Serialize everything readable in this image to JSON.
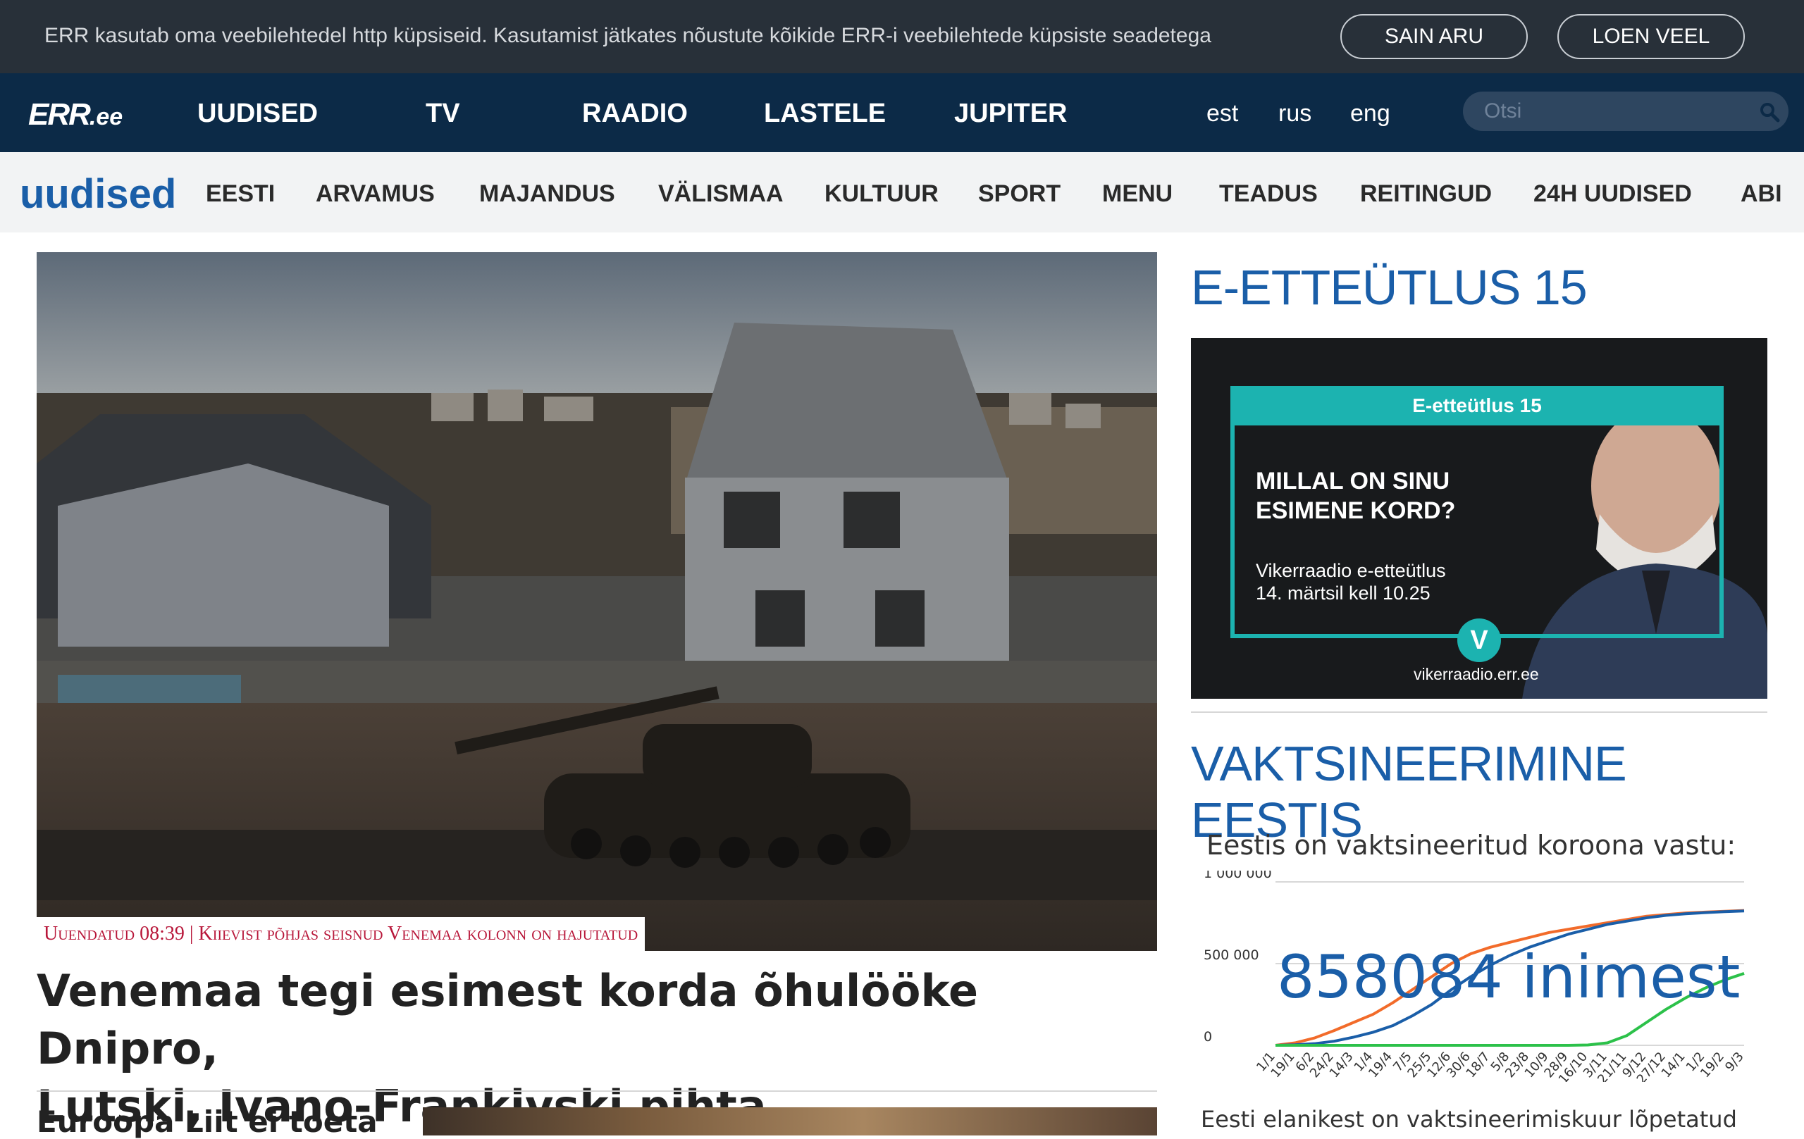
{
  "cookie": {
    "text": "ERR kasutab oma veebilehtedel http küpsiseid. Kasutamist jätkates nõustute kõikide ERR-i veebilehtede küpsiste seadetega",
    "accept_label": "SAIN ARU",
    "more_label": "LOEN VEEL"
  },
  "top_nav": {
    "logo_mark": "ERR",
    "logo_domain": ".ee",
    "items": [
      "UUDISED",
      "TV",
      "RAADIO",
      "LASTELE",
      "JUPITER"
    ],
    "languages": [
      "est",
      "rus",
      "eng"
    ],
    "search_placeholder": "Otsi"
  },
  "section_nav": {
    "brand": "uudised",
    "items": [
      "EESTI",
      "ARVAMUS",
      "MAJANDUS",
      "VÄLISMAA",
      "KULTUUR",
      "SPORT",
      "MENU",
      "TEADUS",
      "REITINGUD",
      "24H UUDISED",
      "ABI"
    ]
  },
  "main": {
    "hero_caption": "Uuendatud 08:39 | Kiievist põhjas seisnud Venemaa kolonn on hajutatud",
    "hero_title_line1": "Venemaa tegi esimest korda õhulööke Dnipro,",
    "hero_title_line2": "Lutski, Ivano-Frankivski pihta",
    "second_title": "Euroopa Liit ei toeta"
  },
  "sidebar": {
    "promo_heading": "E-ETTEÜTLUS 15",
    "promo": {
      "tag": "E-etteütlus 15",
      "question_line1": "MILLAL ON SINU",
      "question_line2": "ESIMENE KORD?",
      "info_line1": "Vikerraadio e-etteütlus",
      "info_line2": "14. märtsil kell 10.25",
      "logo_letter": "V",
      "url": "vikerraadio.err.ee"
    },
    "vacc_heading": "VAKTSINEERIMINE EESTIS",
    "vacc_subtitle": "Eestis on vaktsineeritud koroona vastu:",
    "vacc_count": "858084",
    "vacc_unit": "inimest",
    "vacc_footer": "Eesti elanikest on vaktsineerimiskuur lõpetatud"
  },
  "chart_data": {
    "type": "line",
    "x": [
      "1/1",
      "19/1",
      "6/2",
      "24/2",
      "14/3",
      "1/4",
      "19/4",
      "7/5",
      "25/5",
      "12/6",
      "30/6",
      "18/7",
      "5/8",
      "23/8",
      "10/9",
      "28/9",
      "16/10",
      "3/11",
      "21/11",
      "9/12",
      "27/12",
      "14/1",
      "1/2",
      "19/2",
      "9/3"
    ],
    "yticks": [
      "1 000 000",
      "500 000",
      "0"
    ],
    "ylim": [
      0,
      1000000
    ],
    "series": [
      {
        "color": "#f26b2a",
        "values": [
          0,
          15000,
          45000,
          90000,
          140000,
          190000,
          260000,
          340000,
          420000,
          500000,
          560000,
          600000,
          630000,
          660000,
          690000,
          710000,
          730000,
          750000,
          770000,
          790000,
          800000,
          810000,
          815000,
          820000,
          825000
        ]
      },
      {
        "color": "#1a5ea8",
        "values": [
          0,
          3000,
          10000,
          25000,
          50000,
          80000,
          120000,
          180000,
          250000,
          340000,
          420000,
          490000,
          550000,
          600000,
          640000,
          680000,
          710000,
          740000,
          760000,
          780000,
          795000,
          805000,
          812000,
          818000,
          822000
        ]
      },
      {
        "color": "#2cc14a",
        "values": [
          0,
          0,
          0,
          0,
          0,
          0,
          0,
          0,
          0,
          0,
          0,
          0,
          0,
          0,
          0,
          0,
          2000,
          15000,
          60000,
          140000,
          220000,
          290000,
          350000,
          400000,
          440000
        ]
      }
    ]
  }
}
